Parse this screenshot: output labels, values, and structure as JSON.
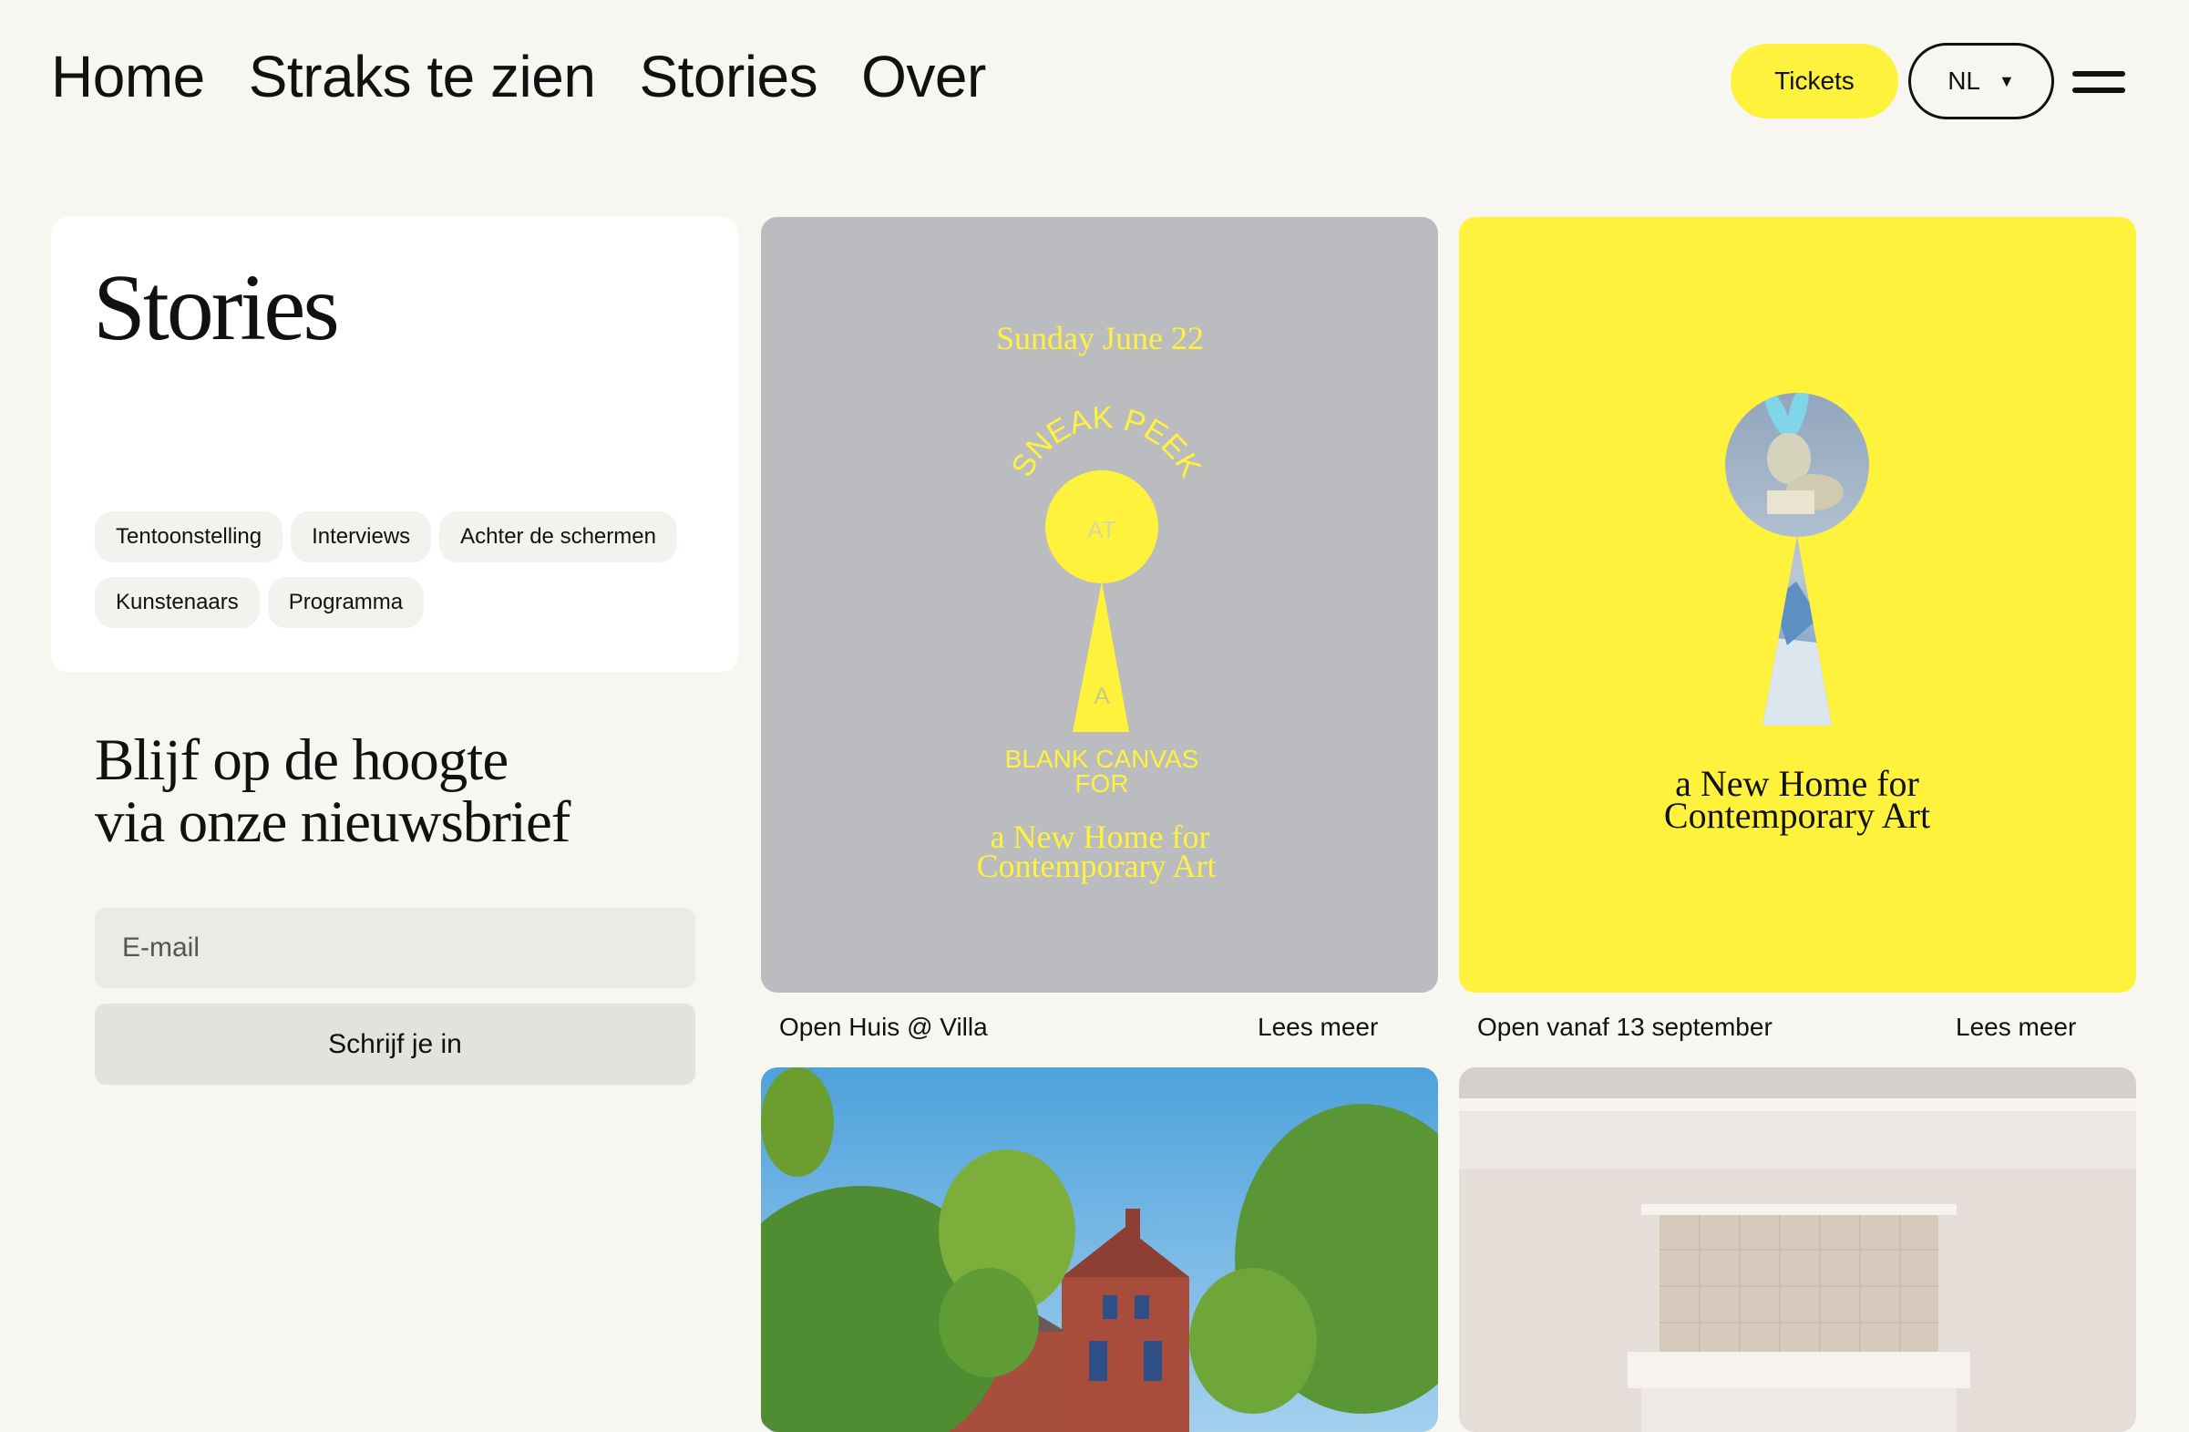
{
  "nav": {
    "items": [
      "Home",
      "Straks te zien",
      "Stories",
      "Over"
    ],
    "tickets_label": "Tickets",
    "language": "NL",
    "menu_icon": "hamburger-icon"
  },
  "stories": {
    "title": "Stories",
    "tags": [
      "Tentoonstelling",
      "Interviews",
      "Achter de schermen",
      "Kunstenaars",
      "Programma"
    ]
  },
  "newsletter": {
    "title_line1": "Blijf op de hoogte",
    "title_line2": "via onze nieuwsbrief",
    "email_placeholder": "E-mail",
    "subscribe_label": "Schrijf je in"
  },
  "cards": [
    {
      "poster": {
        "date": "Sunday June 22",
        "arc_text": "SNEAK PEEK",
        "at": "AT",
        "a": "A",
        "line1": "BLANK CANVAS",
        "line2": "FOR",
        "tag1": "a New Home for",
        "tag2": "Contemporary Art"
      },
      "caption": "Open Huis @ Villa",
      "link": "Lees meer"
    },
    {
      "poster": {
        "tag1": "a New Home for",
        "tag2": "Contemporary Art"
      },
      "caption": "Open vanaf 13 september",
      "link": "Lees meer"
    },
    {
      "image": "villa-photo"
    },
    {
      "image": "interior-photo"
    }
  ],
  "colors": {
    "background": "#f7f6f1",
    "accent_yellow": "#fff23c",
    "poster_gray": "#bbbcbf",
    "card_white": "#ffffff"
  }
}
